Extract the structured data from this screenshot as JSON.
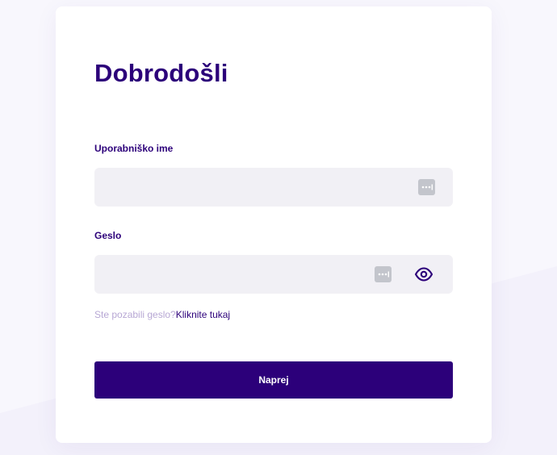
{
  "login": {
    "title": "Dobrodošli",
    "username_label": "Uporabniško ime",
    "username_value": "",
    "password_label": "Geslo",
    "password_value": "",
    "forgot_text": "Ste pozabili geslo?",
    "forgot_link": "Kliknite tukaj",
    "submit_label": "Naprej"
  },
  "icons": {
    "password_manager": "password-manager-icon",
    "show_password": "eye-icon"
  },
  "colors": {
    "brand": "#2c007a",
    "input_background": "#f1f0f5",
    "muted_text": "#b7a7d4",
    "page_background": "#f8f7fd",
    "card_background": "#ffffff"
  }
}
